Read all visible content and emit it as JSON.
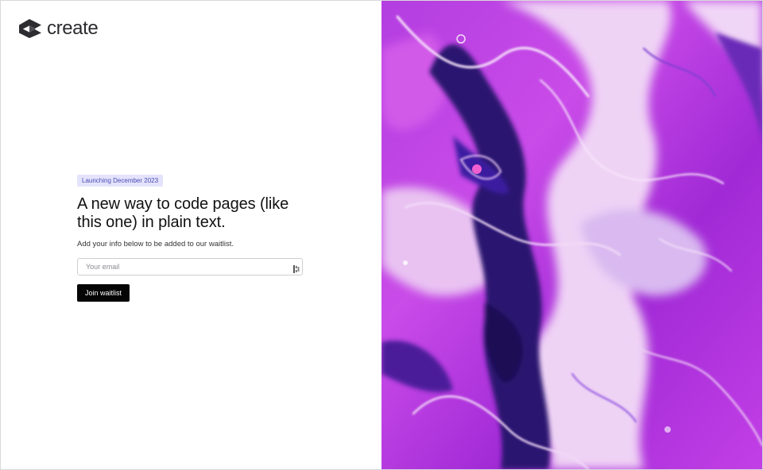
{
  "brand": {
    "name": "create",
    "logo_icon": "create-logo-icon"
  },
  "hero": {
    "badge": "Launching December 2023",
    "headline": "A new way to code pages (like this one) in plain text.",
    "subtext": "Add your info below to be added to our waitlist."
  },
  "form": {
    "email_value": "",
    "email_placeholder": "Your email",
    "autofill_icon": "password-manager-icon",
    "submit_label": "Join waitlist"
  },
  "image": {
    "description_icon": "abstract-fluid-art-image"
  },
  "colors": {
    "badge_bg": "#e4e3fb",
    "badge_text": "#4a4bb8",
    "button_bg": "#050505",
    "art_primary": "#a92ee0",
    "art_secondary": "#2a1470",
    "art_highlight": "#f2d6f7"
  }
}
